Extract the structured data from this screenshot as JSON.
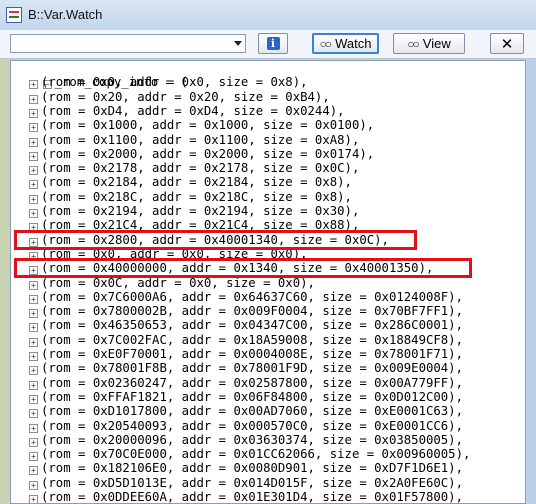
{
  "window": {
    "title": "B::Var.Watch"
  },
  "toolbar": {
    "combo_value": "",
    "info_icon": "info-icon",
    "watch_label": "Watch",
    "view_label": "View",
    "close_icon": "close-x-icon"
  },
  "tree": {
    "root_label": "_rom_copy_info = (",
    "expander_collapsed": "+",
    "expander_expanded": "−",
    "entries": [
      "(rom = 0x0, addr = 0x0, size = 0x8),",
      "(rom = 0x20, addr = 0x20, size = 0xB4),",
      "(rom = 0xD4, addr = 0xD4, size = 0x0244),",
      "(rom = 0x1000, addr = 0x1000, size = 0x0100),",
      "(rom = 0x1100, addr = 0x1100, size = 0xA8),",
      "(rom = 0x2000, addr = 0x2000, size = 0x0174),",
      "(rom = 0x2178, addr = 0x2178, size = 0x0C),",
      "(rom = 0x2184, addr = 0x2184, size = 0x8),",
      "(rom = 0x218C, addr = 0x218C, size = 0x8),",
      "(rom = 0x2194, addr = 0x2194, size = 0x30),",
      "(rom = 0x21C4, addr = 0x21C4, size = 0x88),",
      "(rom = 0x2800, addr = 0x40001340, size = 0x0C),",
      "(rom = 0x0, addr = 0x0, size = 0x0),",
      "(rom = 0x40000000, addr = 0x1340, size = 0x40001350),",
      "(rom = 0x0C, addr = 0x0, size = 0x0),",
      "(rom = 0x7C6000A6, addr = 0x64637C60, size = 0x0124008F),",
      "(rom = 0x7800002B, addr = 0x009F0004, size = 0x70BF7FF1),",
      "(rom = 0x46350653, addr = 0x04347C00, size = 0x286C0001),",
      "(rom = 0x7C002FAC, addr = 0x18A59008, size = 0x18849CF8),",
      "(rom = 0xE0F70001, addr = 0x0004008E, size = 0x78001F71),",
      "(rom = 0x78001F8B, addr = 0x78001F9D, size = 0x009E0004),",
      "(rom = 0x02360247, addr = 0x02587800, size = 0x00A779FF),",
      "(rom = 0xFFAF1821, addr = 0x06F84800, size = 0x0D012C00),",
      "(rom = 0xD1017800, addr = 0x00AD7060, size = 0xE0001C63),",
      "(rom = 0x20540093, addr = 0x000570C0, size = 0xE0001CC6),",
      "(rom = 0x20000096, addr = 0x03630374, size = 0x03850005),",
      "(rom = 0x70C0E000, addr = 0x01CC62066, size = 0x00960005),",
      "(rom = 0x182106E0, addr = 0x0080D901, size = 0xD7F1D6E1),",
      "(rom = 0xD5D1013E, addr = 0x014D015F, size = 0x2A0FE60C),",
      "(rom = 0x0DDEE60A, addr = 0x01E301D4, size = 0x01F57800),"
    ]
  },
  "highlight_color": "#e0101a"
}
